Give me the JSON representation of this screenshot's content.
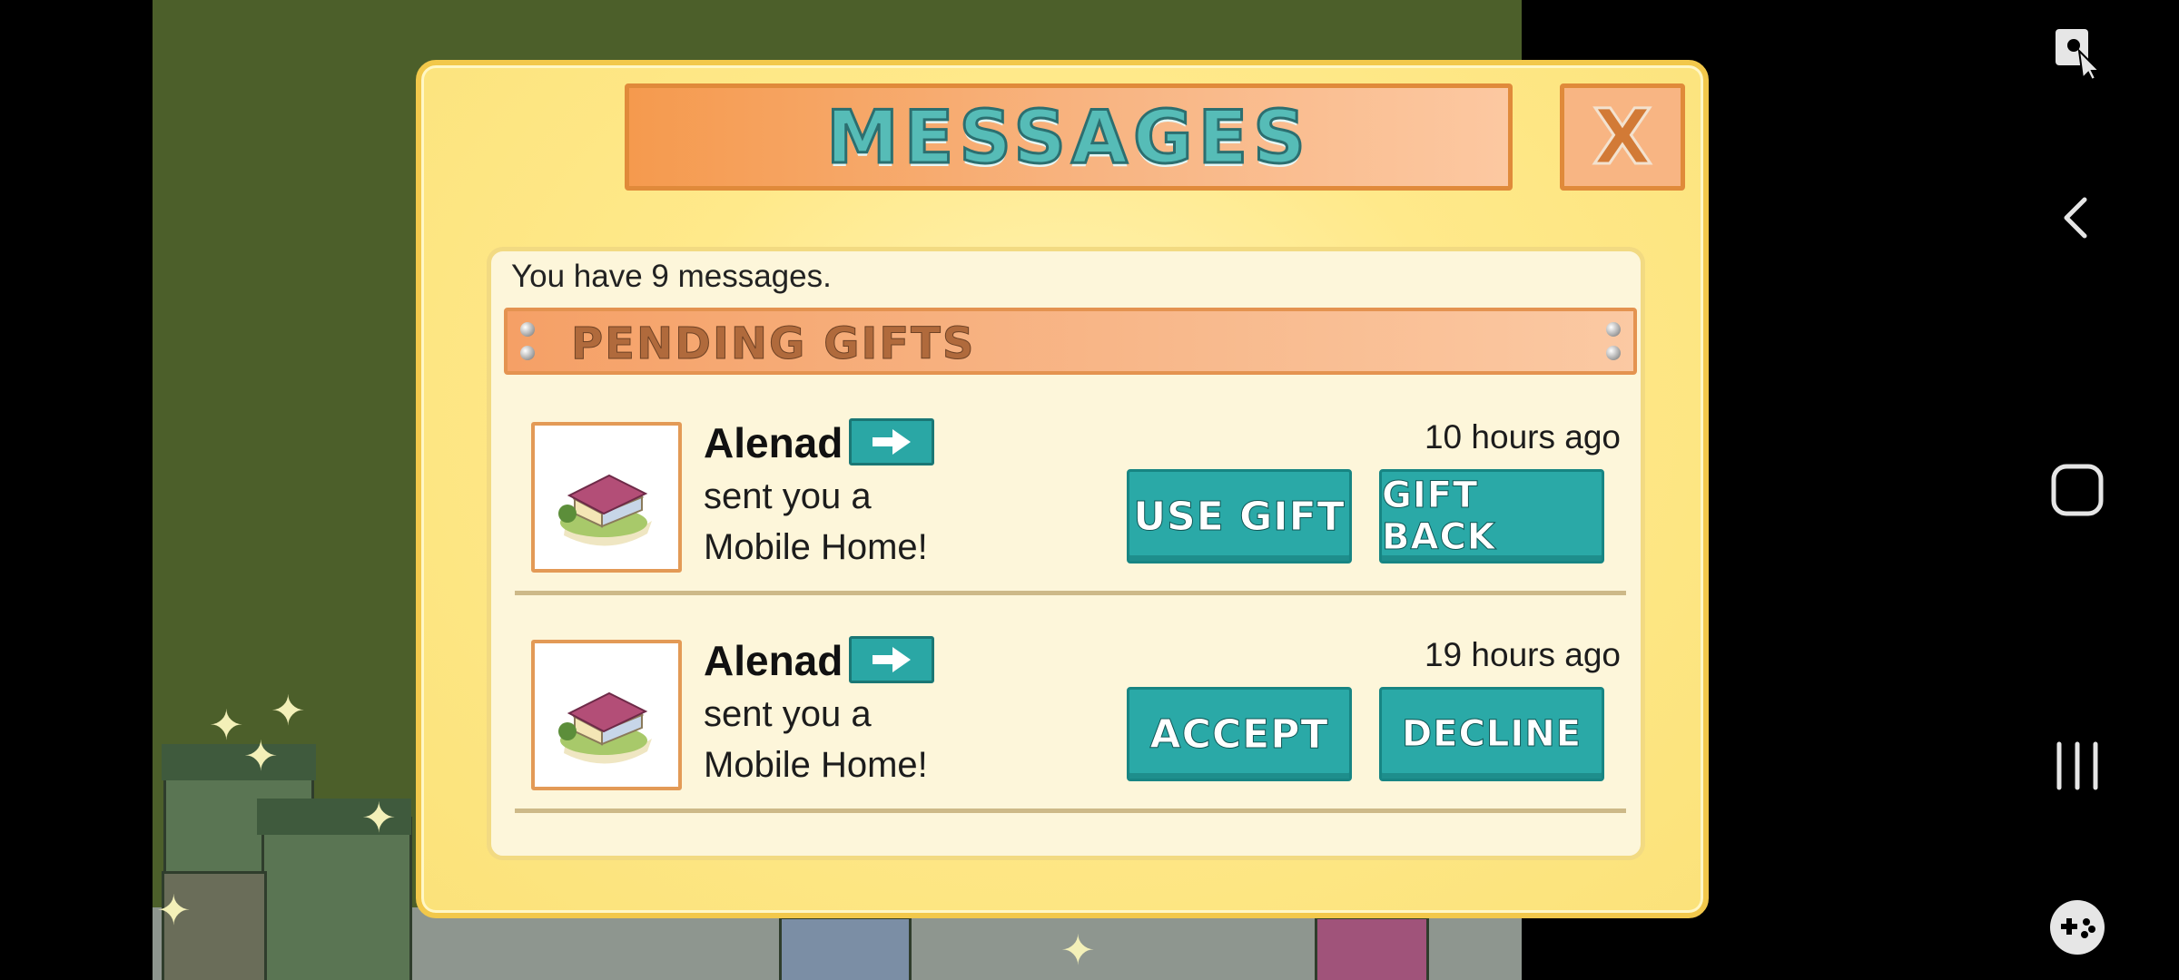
{
  "dialog": {
    "title": "MESSAGES",
    "close_label": "X"
  },
  "summary": {
    "count_text": "You have 9 messages."
  },
  "section": {
    "title": "PENDING GIFTS"
  },
  "messages": [
    {
      "sender": "Alenad",
      "line1": "sent you a",
      "line2": "Mobile Home!",
      "time": "10 hours ago",
      "primary_label": "USE GIFT",
      "secondary_label": "GIFT BACK",
      "icon": "mobile-home-icon"
    },
    {
      "sender": "Alenad",
      "line1": "sent you a",
      "line2": "Mobile Home!",
      "time": "19 hours ago",
      "primary_label": "ACCEPT",
      "secondary_label": "DECLINE",
      "icon": "mobile-home-icon"
    }
  ],
  "nav": {
    "icons": [
      "screen-tap-icon",
      "back-icon",
      "home-icon",
      "recents-icon",
      "game-tools-icon"
    ]
  },
  "colors": {
    "dialog_bg": "#ffe98a",
    "banner": "#f59a4e",
    "button": "#2aa9a7",
    "title_text": "#56bcb7"
  }
}
